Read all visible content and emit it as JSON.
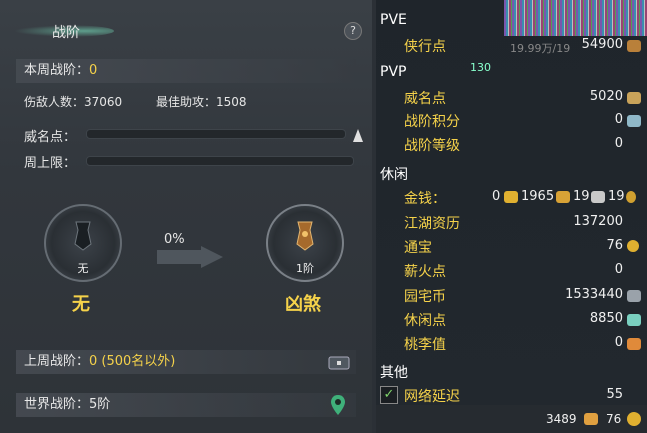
{
  "left": {
    "title": "战阶",
    "help": "?",
    "week_rank_label": "本周战阶：",
    "week_rank_value": "0",
    "kills_label": "伤敌人数：",
    "kills_value": "37060",
    "assist_label": "最佳助攻：",
    "assist_value": "1508",
    "fame_label": "威名点：",
    "cap_label": "周上限：",
    "current": {
      "level": "无",
      "name": "无"
    },
    "progress": "0%",
    "next": {
      "level": "1阶",
      "name": "凶煞"
    },
    "last_week_label": "上周战阶：",
    "last_week_value": "0 (500名以外)",
    "world_label": "世界战阶：",
    "world_value": "5阶"
  },
  "right": {
    "pve": {
      "title": "PVE",
      "items": [
        {
          "label": "侠行点",
          "value": "54900"
        }
      ]
    },
    "pvp": {
      "title": "PVP",
      "items": [
        {
          "label": "威名点",
          "value": "5020"
        },
        {
          "label": "战阶积分",
          "value": "0"
        },
        {
          "label": "战阶等级",
          "value": "0"
        }
      ]
    },
    "leisure": {
      "title": "休闲",
      "money_label": "金钱：",
      "money": [
        "0",
        "1965",
        "19",
        "19"
      ],
      "items": [
        {
          "label": "江湖资历",
          "value": "137200"
        },
        {
          "label": "通宝",
          "value": "76"
        },
        {
          "label": "薪火点",
          "value": "0"
        },
        {
          "label": "园宅币",
          "value": "1533440"
        },
        {
          "label": "休闲点",
          "value": "8850"
        },
        {
          "label": "桃李值",
          "value": "0"
        }
      ]
    },
    "other": {
      "title": "其他",
      "latency_label": "网络延迟",
      "latency_value": "55"
    },
    "bottom": {
      "points": "3489",
      "coins": "76"
    },
    "top_hint": "19.99万/19",
    "top_level": "130"
  },
  "colors": {
    "accent": "#f5d24a",
    "panel": "#3a4046",
    "right_panel": "#1f252b"
  }
}
